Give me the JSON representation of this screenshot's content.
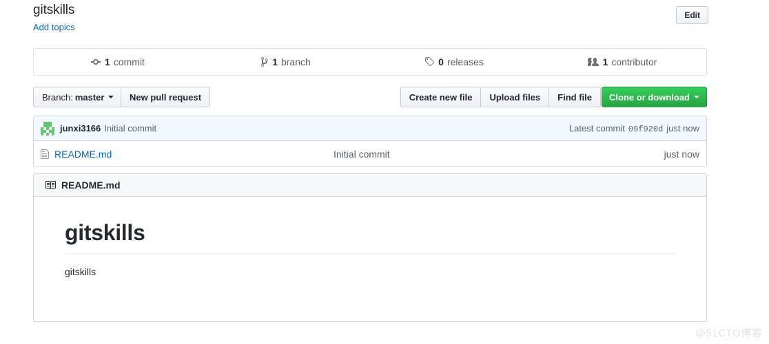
{
  "header": {
    "repo_name": "gitskills",
    "add_topics_label": "Add topics",
    "edit_label": "Edit"
  },
  "stats": [
    {
      "icon": "git-commit-icon",
      "count": "1",
      "label": "commit"
    },
    {
      "icon": "git-branch-icon",
      "count": "1",
      "label": "branch"
    },
    {
      "icon": "tag-icon",
      "count": "0",
      "label": "releases"
    },
    {
      "icon": "people-icon",
      "count": "1",
      "label": "contributor"
    }
  ],
  "toolbar": {
    "branch_prefix": "Branch:",
    "branch_name": "master",
    "new_pull_request": "New pull request",
    "create_new_file": "Create new file",
    "upload_files": "Upload files",
    "find_file": "Find file",
    "clone_or_download": "Clone or download",
    "clone_button_color": "#28a745"
  },
  "commit_row": {
    "author": "junxi3166",
    "message": "Initial commit",
    "latest_commit_label": "Latest commit",
    "sha": "09f920d",
    "age": "just now",
    "row_background": "#f1f8ff"
  },
  "files": [
    {
      "icon": "file-icon",
      "name": "README.md",
      "commit_message": "Initial commit",
      "age": "just now"
    }
  ],
  "readme": {
    "icon": "book-icon",
    "title": "README.md",
    "heading": "gitskills",
    "body": "gitskills"
  },
  "watermark": "@51CTO博客"
}
